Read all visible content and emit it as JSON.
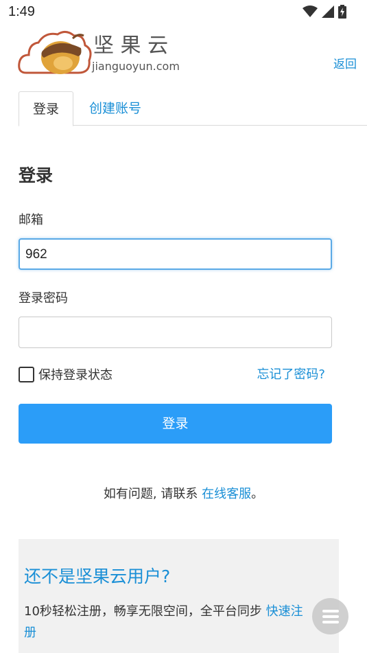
{
  "status_bar": {
    "time": "1:49",
    "icons": [
      "wifi-icon",
      "cellular-signal-icon",
      "battery-charging-icon"
    ]
  },
  "header": {
    "logo_text": "坚 果 云",
    "logo_domain": "jianguoyun.com",
    "back_label": "返回"
  },
  "tabs": [
    {
      "label": "登录",
      "active": true
    },
    {
      "label": "创建账号",
      "active": false
    }
  ],
  "form": {
    "title": "登录",
    "email_label": "邮箱",
    "email_value": "962",
    "password_label": "登录密码",
    "password_value": "",
    "remember_label": "保持登录状态",
    "forgot_label": "忘记了密码?",
    "submit_label": "登录"
  },
  "help": {
    "prefix": "如有问题, 请联系 ",
    "link": "在线客服",
    "suffix": "。"
  },
  "promo": {
    "title": "还不是坚果云用户?",
    "text": "10秒轻松注册，畅享无限空间，全平台同步 ",
    "link": "快速注册"
  },
  "colors": {
    "link": "#1a8fd6",
    "primary_button": "#2b9df8",
    "promo_bg": "#f1f1f1"
  }
}
